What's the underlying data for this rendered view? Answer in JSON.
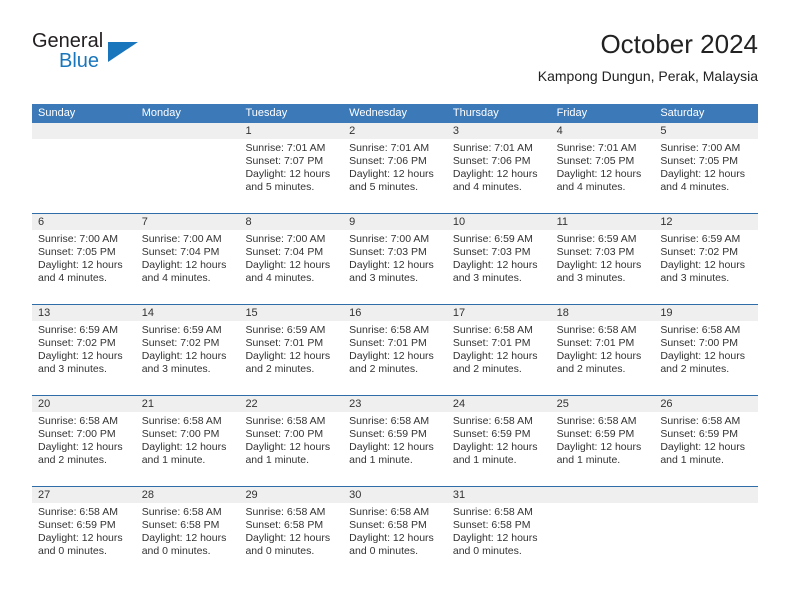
{
  "logo": {
    "line1": "General",
    "line2": "Blue",
    "triangle_icon": "triangle-icon",
    "blue": "#1a76bc"
  },
  "header": {
    "title": "October 2024",
    "subtitle": "Kampong Dungun, Perak, Malaysia"
  },
  "colors": {
    "header_band": "#3c79b8",
    "row_separator": "#2e6da8",
    "daynum_band": "#efefef",
    "text": "#333333"
  },
  "weekdays": [
    "Sunday",
    "Monday",
    "Tuesday",
    "Wednesday",
    "Thursday",
    "Friday",
    "Saturday"
  ],
  "weeks": [
    [
      {
        "day": "",
        "sunrise": "",
        "sunset": "",
        "daylight1": "",
        "daylight2": ""
      },
      {
        "day": "",
        "sunrise": "",
        "sunset": "",
        "daylight1": "",
        "daylight2": ""
      },
      {
        "day": "1",
        "sunrise": "Sunrise: 7:01 AM",
        "sunset": "Sunset: 7:07 PM",
        "daylight1": "Daylight: 12 hours",
        "daylight2": "and 5 minutes."
      },
      {
        "day": "2",
        "sunrise": "Sunrise: 7:01 AM",
        "sunset": "Sunset: 7:06 PM",
        "daylight1": "Daylight: 12 hours",
        "daylight2": "and 5 minutes."
      },
      {
        "day": "3",
        "sunrise": "Sunrise: 7:01 AM",
        "sunset": "Sunset: 7:06 PM",
        "daylight1": "Daylight: 12 hours",
        "daylight2": "and 4 minutes."
      },
      {
        "day": "4",
        "sunrise": "Sunrise: 7:01 AM",
        "sunset": "Sunset: 7:05 PM",
        "daylight1": "Daylight: 12 hours",
        "daylight2": "and 4 minutes."
      },
      {
        "day": "5",
        "sunrise": "Sunrise: 7:00 AM",
        "sunset": "Sunset: 7:05 PM",
        "daylight1": "Daylight: 12 hours",
        "daylight2": "and 4 minutes."
      }
    ],
    [
      {
        "day": "6",
        "sunrise": "Sunrise: 7:00 AM",
        "sunset": "Sunset: 7:05 PM",
        "daylight1": "Daylight: 12 hours",
        "daylight2": "and 4 minutes."
      },
      {
        "day": "7",
        "sunrise": "Sunrise: 7:00 AM",
        "sunset": "Sunset: 7:04 PM",
        "daylight1": "Daylight: 12 hours",
        "daylight2": "and 4 minutes."
      },
      {
        "day": "8",
        "sunrise": "Sunrise: 7:00 AM",
        "sunset": "Sunset: 7:04 PM",
        "daylight1": "Daylight: 12 hours",
        "daylight2": "and 4 minutes."
      },
      {
        "day": "9",
        "sunrise": "Sunrise: 7:00 AM",
        "sunset": "Sunset: 7:03 PM",
        "daylight1": "Daylight: 12 hours",
        "daylight2": "and 3 minutes."
      },
      {
        "day": "10",
        "sunrise": "Sunrise: 6:59 AM",
        "sunset": "Sunset: 7:03 PM",
        "daylight1": "Daylight: 12 hours",
        "daylight2": "and 3 minutes."
      },
      {
        "day": "11",
        "sunrise": "Sunrise: 6:59 AM",
        "sunset": "Sunset: 7:03 PM",
        "daylight1": "Daylight: 12 hours",
        "daylight2": "and 3 minutes."
      },
      {
        "day": "12",
        "sunrise": "Sunrise: 6:59 AM",
        "sunset": "Sunset: 7:02 PM",
        "daylight1": "Daylight: 12 hours",
        "daylight2": "and 3 minutes."
      }
    ],
    [
      {
        "day": "13",
        "sunrise": "Sunrise: 6:59 AM",
        "sunset": "Sunset: 7:02 PM",
        "daylight1": "Daylight: 12 hours",
        "daylight2": "and 3 minutes."
      },
      {
        "day": "14",
        "sunrise": "Sunrise: 6:59 AM",
        "sunset": "Sunset: 7:02 PM",
        "daylight1": "Daylight: 12 hours",
        "daylight2": "and 3 minutes."
      },
      {
        "day": "15",
        "sunrise": "Sunrise: 6:59 AM",
        "sunset": "Sunset: 7:01 PM",
        "daylight1": "Daylight: 12 hours",
        "daylight2": "and 2 minutes."
      },
      {
        "day": "16",
        "sunrise": "Sunrise: 6:58 AM",
        "sunset": "Sunset: 7:01 PM",
        "daylight1": "Daylight: 12 hours",
        "daylight2": "and 2 minutes."
      },
      {
        "day": "17",
        "sunrise": "Sunrise: 6:58 AM",
        "sunset": "Sunset: 7:01 PM",
        "daylight1": "Daylight: 12 hours",
        "daylight2": "and 2 minutes."
      },
      {
        "day": "18",
        "sunrise": "Sunrise: 6:58 AM",
        "sunset": "Sunset: 7:01 PM",
        "daylight1": "Daylight: 12 hours",
        "daylight2": "and 2 minutes."
      },
      {
        "day": "19",
        "sunrise": "Sunrise: 6:58 AM",
        "sunset": "Sunset: 7:00 PM",
        "daylight1": "Daylight: 12 hours",
        "daylight2": "and 2 minutes."
      }
    ],
    [
      {
        "day": "20",
        "sunrise": "Sunrise: 6:58 AM",
        "sunset": "Sunset: 7:00 PM",
        "daylight1": "Daylight: 12 hours",
        "daylight2": "and 2 minutes."
      },
      {
        "day": "21",
        "sunrise": "Sunrise: 6:58 AM",
        "sunset": "Sunset: 7:00 PM",
        "daylight1": "Daylight: 12 hours",
        "daylight2": "and 1 minute."
      },
      {
        "day": "22",
        "sunrise": "Sunrise: 6:58 AM",
        "sunset": "Sunset: 7:00 PM",
        "daylight1": "Daylight: 12 hours",
        "daylight2": "and 1 minute."
      },
      {
        "day": "23",
        "sunrise": "Sunrise: 6:58 AM",
        "sunset": "Sunset: 6:59 PM",
        "daylight1": "Daylight: 12 hours",
        "daylight2": "and 1 minute."
      },
      {
        "day": "24",
        "sunrise": "Sunrise: 6:58 AM",
        "sunset": "Sunset: 6:59 PM",
        "daylight1": "Daylight: 12 hours",
        "daylight2": "and 1 minute."
      },
      {
        "day": "25",
        "sunrise": "Sunrise: 6:58 AM",
        "sunset": "Sunset: 6:59 PM",
        "daylight1": "Daylight: 12 hours",
        "daylight2": "and 1 minute."
      },
      {
        "day": "26",
        "sunrise": "Sunrise: 6:58 AM",
        "sunset": "Sunset: 6:59 PM",
        "daylight1": "Daylight: 12 hours",
        "daylight2": "and 1 minute."
      }
    ],
    [
      {
        "day": "27",
        "sunrise": "Sunrise: 6:58 AM",
        "sunset": "Sunset: 6:59 PM",
        "daylight1": "Daylight: 12 hours",
        "daylight2": "and 0 minutes."
      },
      {
        "day": "28",
        "sunrise": "Sunrise: 6:58 AM",
        "sunset": "Sunset: 6:58 PM",
        "daylight1": "Daylight: 12 hours",
        "daylight2": "and 0 minutes."
      },
      {
        "day": "29",
        "sunrise": "Sunrise: 6:58 AM",
        "sunset": "Sunset: 6:58 PM",
        "daylight1": "Daylight: 12 hours",
        "daylight2": "and 0 minutes."
      },
      {
        "day": "30",
        "sunrise": "Sunrise: 6:58 AM",
        "sunset": "Sunset: 6:58 PM",
        "daylight1": "Daylight: 12 hours",
        "daylight2": "and 0 minutes."
      },
      {
        "day": "31",
        "sunrise": "Sunrise: 6:58 AM",
        "sunset": "Sunset: 6:58 PM",
        "daylight1": "Daylight: 12 hours",
        "daylight2": "and 0 minutes."
      },
      {
        "day": "",
        "sunrise": "",
        "sunset": "",
        "daylight1": "",
        "daylight2": ""
      },
      {
        "day": "",
        "sunrise": "",
        "sunset": "",
        "daylight1": "",
        "daylight2": ""
      }
    ]
  ]
}
